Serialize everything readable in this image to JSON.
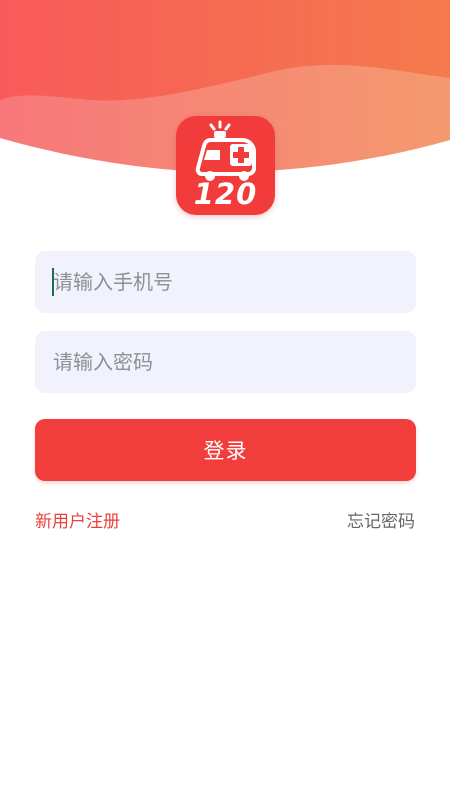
{
  "app": {
    "logo_text": "120",
    "logo_icon": "ambulance-icon"
  },
  "form": {
    "phone_placeholder": "请输入手机号",
    "phone_value": "",
    "password_placeholder": "请输入密码",
    "password_value": "",
    "login_label": "登录"
  },
  "links": {
    "register_label": "新用户注册",
    "forgot_label": "忘记密码"
  },
  "colors": {
    "header_gradient_start": "#f85a5a",
    "header_gradient_end": "#f57a4c",
    "primary": "#f23d3d",
    "input_background": "#f1f2fb",
    "link_accent": "#e8403c",
    "link_muted": "#666666"
  }
}
